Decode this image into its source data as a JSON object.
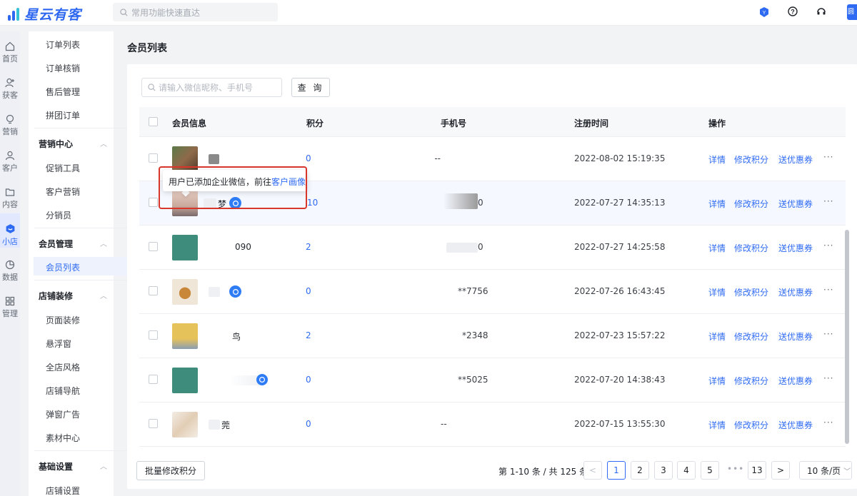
{
  "app": {
    "name": "星云有客",
    "search_placeholder": "常用功能快速直达",
    "avatar_text": "圆圆"
  },
  "colors": {
    "accent": "#2f6bf2",
    "highlight_box": "#d9362b"
  },
  "leftnav": [
    {
      "label": "首页",
      "icon": "home-icon"
    },
    {
      "label": "获客",
      "icon": "user-add-icon"
    },
    {
      "label": "营销",
      "icon": "bulb-icon"
    },
    {
      "label": "客户",
      "icon": "user-icon"
    },
    {
      "label": "内容",
      "icon": "folder-icon"
    },
    {
      "label": "小店",
      "icon": "shop-icon",
      "active": true
    },
    {
      "label": "数据",
      "icon": "pie-chart-icon"
    },
    {
      "label": "管理",
      "icon": "grid-icon"
    }
  ],
  "submenu": {
    "orders": [
      "订单列表",
      "订单核销",
      "售后管理",
      "拼团订单"
    ],
    "marketing": {
      "title": "营销中心",
      "items": [
        "促销工具",
        "客户营销",
        "分销员"
      ]
    },
    "members": {
      "title": "会员管理",
      "items": [
        "会员列表"
      ]
    },
    "decor": {
      "title": "店铺装修",
      "items": [
        "页面装修",
        "悬浮窗",
        "全店风格",
        "店铺导航",
        "弹窗广告",
        "素材中心"
      ]
    },
    "basic": {
      "title": "基础设置",
      "items": [
        "店铺设置"
      ]
    }
  },
  "page": {
    "title": "会员列表"
  },
  "search": {
    "placeholder": "请输入微信昵称、手机号",
    "button": "查 询"
  },
  "table": {
    "headers": {
      "member_info": "会员信息",
      "points": "积分",
      "phone": "手机号",
      "reg_time": "注册时间",
      "actions": "操作"
    },
    "actions": {
      "detail": "详情",
      "edit_points": "修改积分",
      "send_coupon": "送优惠券",
      "more": "···"
    },
    "rows": [
      {
        "name": "",
        "points": "0",
        "phone": "--",
        "reg_time": "2022-08-02 15:19:35",
        "wechat": false
      },
      {
        "name": "梦",
        "points": "10",
        "phone": "0",
        "reg_time": "2022-07-27 14:35:13",
        "wechat": true
      },
      {
        "name": "090",
        "points": "2",
        "phone": "0",
        "reg_time": "2022-07-27 14:25:58",
        "wechat": false
      },
      {
        "name": "",
        "points": "0",
        "phone": "**7756",
        "reg_time": "2022-07-26 16:43:45",
        "wechat": true
      },
      {
        "name": "鸟",
        "points": "2",
        "phone": "*2348",
        "reg_time": "2022-07-23 15:57:22",
        "wechat": false
      },
      {
        "name": "",
        "points": "0",
        "phone": "**5025",
        "reg_time": "2022-07-20 14:38:43",
        "wechat": true
      },
      {
        "name": "莞",
        "points": "0",
        "phone": "--",
        "reg_time": "2022-07-15 13:55:30",
        "wechat": false
      }
    ]
  },
  "tooltip": {
    "text": "用户已添加企业微信，前往",
    "link": "客户画像"
  },
  "footer": {
    "batch_button": "批量修改积分",
    "total": "第 1-10 条 / 共 125 条",
    "pages": [
      "1",
      "2",
      "3",
      "4",
      "5",
      "13"
    ],
    "prev": "<",
    "next": ">",
    "ellipsis": "•••",
    "page_size": "10 条/页"
  }
}
